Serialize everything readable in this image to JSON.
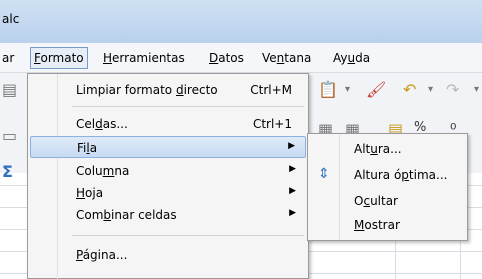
{
  "window": {
    "title_fragment": "alc"
  },
  "menubar": {
    "items": [
      {
        "pre": "ar",
        "ul": "",
        "post": ""
      },
      {
        "pre": "",
        "ul": "F",
        "post": "ormato"
      },
      {
        "pre": "",
        "ul": "H",
        "post": "erramientas"
      },
      {
        "pre": "",
        "ul": "D",
        "post": "atos"
      },
      {
        "pre": "Ve",
        "ul": "n",
        "post": "tana"
      },
      {
        "pre": "Ay",
        "ul": "u",
        "post": "da"
      }
    ]
  },
  "format_menu": {
    "items": [
      {
        "pre": "Limpiar formato ",
        "ul": "d",
        "post": "irecto",
        "shortcut": "Ctrl+M"
      },
      {
        "pre": "Cel",
        "ul": "d",
        "post": "as...",
        "shortcut": "Ctrl+1"
      },
      {
        "pre": "Fi",
        "ul": "l",
        "post": "a",
        "submenu": true
      },
      {
        "pre": "Colu",
        "ul": "m",
        "post": "na",
        "submenu": true
      },
      {
        "pre": "",
        "ul": "H",
        "post": "oja",
        "submenu": true
      },
      {
        "pre": "Com",
        "ul": "b",
        "post": "inar celdas",
        "submenu": true
      },
      {
        "pre": "",
        "ul": "P",
        "post": "ágina..."
      }
    ]
  },
  "row_submenu": {
    "items": [
      {
        "pre": "Alt",
        "ul": "u",
        "post": "ra...",
        "icon": ""
      },
      {
        "pre": "Altura ó",
        "ul": "p",
        "post": "tima...",
        "icon": "row-height-icon"
      },
      {
        "pre": "O",
        "ul": "c",
        "post": "ultar",
        "icon": ""
      },
      {
        "pre": "",
        "ul": "M",
        "post": "ostrar",
        "icon": ""
      }
    ]
  },
  "colors": {
    "highlight": "#c7daf2",
    "menu_bg": "#f5f5f5",
    "titlebar": "#b9d1ec"
  }
}
